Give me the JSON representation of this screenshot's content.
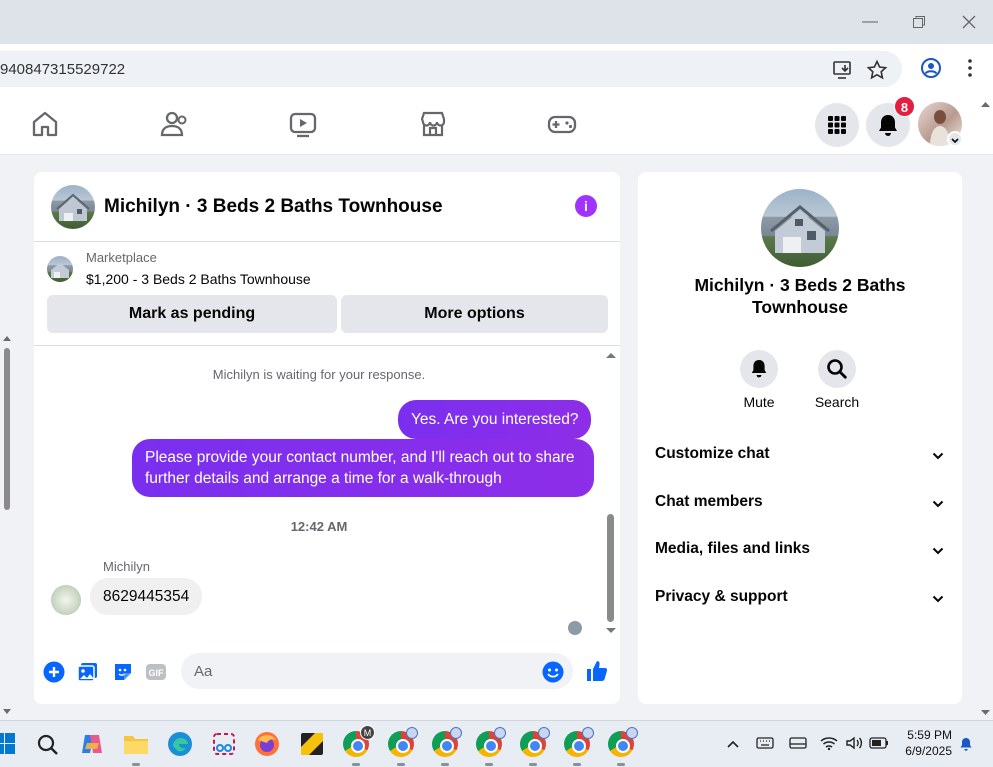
{
  "browser": {
    "address_partial": "940847315529722"
  },
  "nav": {
    "notification_count": "8"
  },
  "chat": {
    "title": "Michilyn · 3 Beds 2 Baths Townhouse",
    "marketplace_label": "Marketplace",
    "listing": "$1,200 - 3 Beds 2 Baths Townhouse",
    "mark_pending": "Mark as pending",
    "more_options": "More options",
    "waiting_notice": "Michilyn is waiting for your response.",
    "outgoing_1": "Yes. Are you interested?",
    "outgoing_2": "Please provide your contact number, and I'll reach out to share further details and arrange a time for a walk-through",
    "timestamp": "12:42 AM",
    "sender_name": "Michilyn",
    "incoming_1": "8629445354",
    "composer_placeholder": "Aa"
  },
  "panel": {
    "title": "Michilyn · 3 Beds 2 Baths Townhouse",
    "mute_label": "Mute",
    "search_label": "Search",
    "sections": [
      "Customize chat",
      "Chat members",
      "Media, files and links",
      "Privacy & support"
    ]
  },
  "taskbar": {
    "time": "5:59 PM",
    "date": "6/9/2025",
    "profile_letter": "M"
  },
  "colors": {
    "accent_purple": "#8a2be2",
    "messenger_blue": "#0866ff",
    "badge_red": "#e41e3f"
  }
}
